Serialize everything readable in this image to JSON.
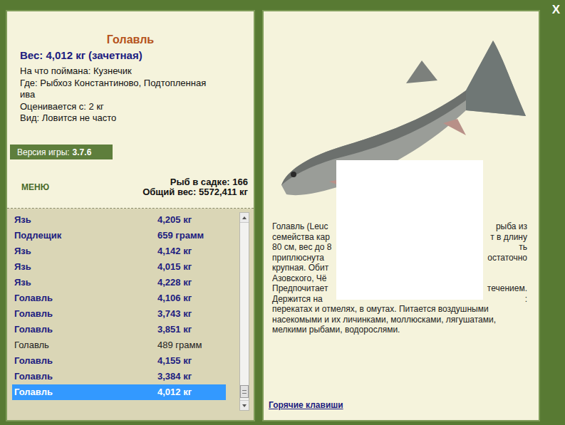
{
  "close_button": "X",
  "catch": {
    "name": "Голавль",
    "weight": "Вес: 4,012 кг (зачетная)",
    "details": [
      "На что поймана: Кузнечик",
      "Где: Рыбхоз Константиново, Подтопленная ива",
      "Оценивается с: 2 кг",
      "Вид: Ловится не часто"
    ]
  },
  "version": {
    "label": "Версия игры:",
    "value": "3.7.6"
  },
  "menu_button": "МЕНЮ",
  "keepnet": {
    "count": "Рыб в садке: 166",
    "total": "Общий вес: 5572,411 кг"
  },
  "catch_list": [
    {
      "name": "Язь",
      "weight": "4,205 кг",
      "trophy": true,
      "selected": false
    },
    {
      "name": "Подлещик",
      "weight": "659 грамм",
      "trophy": true,
      "selected": false
    },
    {
      "name": "Язь",
      "weight": "4,142 кг",
      "trophy": true,
      "selected": false
    },
    {
      "name": "Язь",
      "weight": "4,015 кг",
      "trophy": true,
      "selected": false
    },
    {
      "name": "Язь",
      "weight": "4,228 кг",
      "trophy": true,
      "selected": false
    },
    {
      "name": "Голавль",
      "weight": "4,106 кг",
      "trophy": true,
      "selected": false
    },
    {
      "name": "Голавль",
      "weight": "3,743 кг",
      "trophy": true,
      "selected": false
    },
    {
      "name": "Голавль",
      "weight": "3,851 кг",
      "trophy": true,
      "selected": false
    },
    {
      "name": "Голавль",
      "weight": "489 грамм",
      "trophy": false,
      "selected": false
    },
    {
      "name": "Голавль",
      "weight": "4,155 кг",
      "trophy": true,
      "selected": false
    },
    {
      "name": "Голавль",
      "weight": "3,384 кг",
      "trophy": true,
      "selected": false
    },
    {
      "name": "Голавль",
      "weight": "4,012 кг",
      "trophy": true,
      "selected": true
    }
  ],
  "scrollbar": {
    "level": 0.98
  },
  "description": {
    "lines": [
      {
        "left": "Голавль (Leuc",
        "right": "рыба из"
      },
      {
        "left": "семейства кар",
        "right": "т в длину"
      },
      {
        "left": "80 см, вес до 8",
        "right": "ть"
      },
      {
        "left": "приплюснута",
        "right": "остаточно"
      },
      {
        "left": "крупная. Обит",
        "right": ""
      },
      {
        "left": "Азовского, Чё",
        "right": ""
      },
      {
        "left": "Предпочитает",
        "right": "течением."
      },
      {
        "left": "Держится на",
        "right": ":"
      },
      {
        "left": "перекатах и отмелях, в омутах. Питается воздушными",
        "right": ""
      },
      {
        "left": "насекомыми и их личинками, моллюсками, лягушатами,",
        "right": ""
      },
      {
        "left": "мелкими рыбами, водорослями.",
        "right": ""
      }
    ]
  },
  "hotkeys_link": "Горячие клавиши"
}
